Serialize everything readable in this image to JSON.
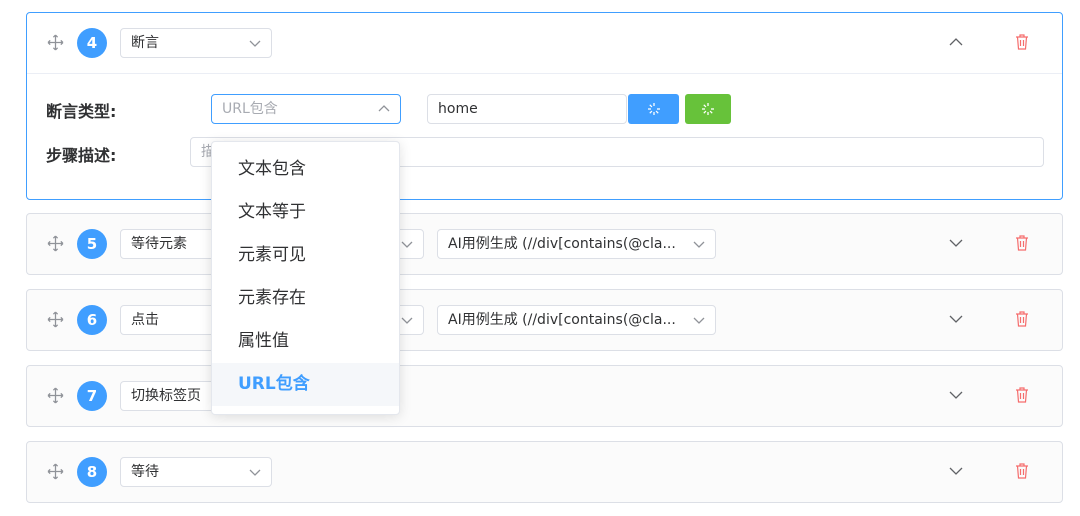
{
  "colors": {
    "accent": "#409eff",
    "success": "#67c23a",
    "danger": "#f56c6c"
  },
  "steps": [
    {
      "number": "4",
      "action": "断言",
      "expanded": true,
      "assert_type_label": "断言类型:",
      "assert_type_value": "URL包含",
      "assert_value": "home",
      "desc_label": "步骤描述:",
      "desc_placeholder": "描"
    },
    {
      "number": "5",
      "action": "等待元素",
      "locator": "AI用例生成 (//div[contains(@cla..."
    },
    {
      "number": "6",
      "action": "点击",
      "locator": "AI用例生成 (//div[contains(@cla..."
    },
    {
      "number": "7",
      "action": "切换标签页"
    },
    {
      "number": "8",
      "action": "等待"
    }
  ],
  "dropdown": {
    "options": [
      "文本包含",
      "文本等于",
      "元素可见",
      "元素存在",
      "属性值",
      "URL包含"
    ],
    "selected": "URL包含"
  },
  "icons": {
    "drag": "move-icon",
    "expand": "chevron-down-icon",
    "collapse": "chevron-up-icon",
    "delete": "trash-icon",
    "loading": "spinner-icon"
  }
}
